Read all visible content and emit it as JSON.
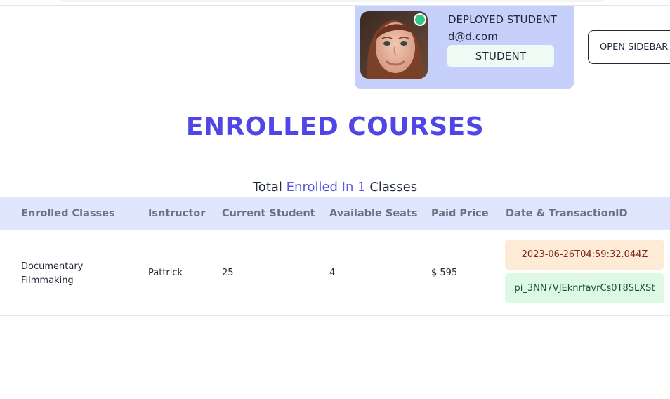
{
  "profile": {
    "name": "DEPLOYED STUDENT",
    "email": "d@d.com",
    "role": "STUDENT",
    "status_color": "#34c58c"
  },
  "header": {
    "open_sidebar_label": "OPEN SIDEBAR"
  },
  "page": {
    "title": "ENROLLED COURSES",
    "summary_prefix": "Total",
    "summary_accent": "Enrolled In 1",
    "summary_suffix": "Classes",
    "accent_color": "#4f46e5"
  },
  "table": {
    "columns": [
      "Enrolled Classes",
      "Isntructor",
      "Current Student",
      "Available Seats",
      "Paid Price",
      "Date & TransactionID"
    ],
    "rows": [
      {
        "course_line1": "Documentary",
        "course_line2": "Filmmaking",
        "instructor": "Pattrick",
        "current_students": "25",
        "available_seats": "4",
        "price": "$ 595",
        "date": "2023-06-26T04:59:32.044Z",
        "transaction_id": "pi_3NN7VJEknrfavrCs0T8SLXSt"
      }
    ]
  }
}
